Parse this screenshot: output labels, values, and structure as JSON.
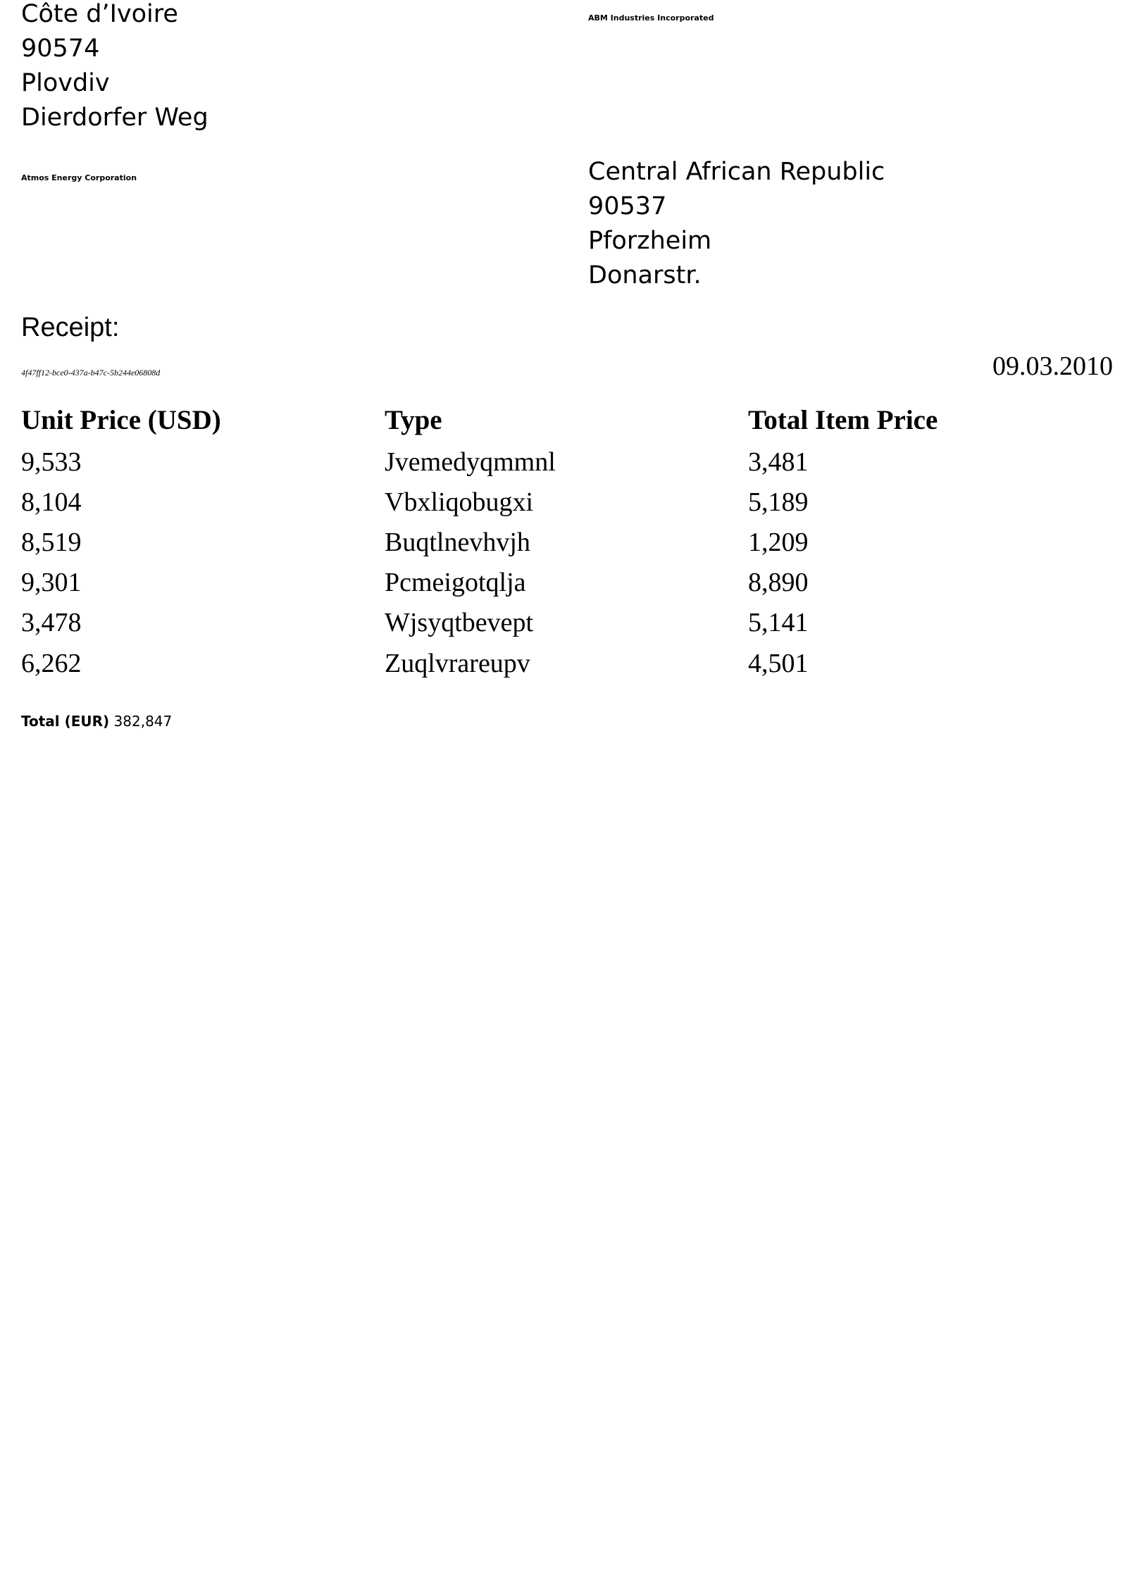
{
  "sender": {
    "address_lines": [
      "Côte d’Ivoire",
      "90574",
      "Plovdiv",
      "Dierdorfer Weg"
    ],
    "company": "ABM Industries Incorporated"
  },
  "recipient": {
    "company": "Atmos Energy Corporation",
    "address_lines": [
      "Central African Republic",
      "90537",
      "Pforzheim",
      "Donarstr."
    ]
  },
  "receipt": {
    "label": "Receipt:",
    "id": "4f47ff12-bce0-437a-b47c-5b244e06808d",
    "date": "09.03.2010"
  },
  "table": {
    "headers": [
      "Unit Price (USD)",
      "Type",
      "Total Item Price"
    ],
    "rows": [
      [
        "9,533",
        "Jvemedyqmmnl",
        "3,481"
      ],
      [
        "8,104",
        "Vbxliqobugxi",
        "5,189"
      ],
      [
        "8,519",
        "Buqtlnevhvjh",
        "1,209"
      ],
      [
        "9,301",
        "Pcmeigotqlja",
        "8,890"
      ],
      [
        "3,478",
        "Wjsyqtbevept",
        "5,141"
      ],
      [
        "6,262",
        "Zuqlvrareupv",
        "4,501"
      ]
    ]
  },
  "total": {
    "label": "Total (EUR)",
    "value": "382,847"
  }
}
